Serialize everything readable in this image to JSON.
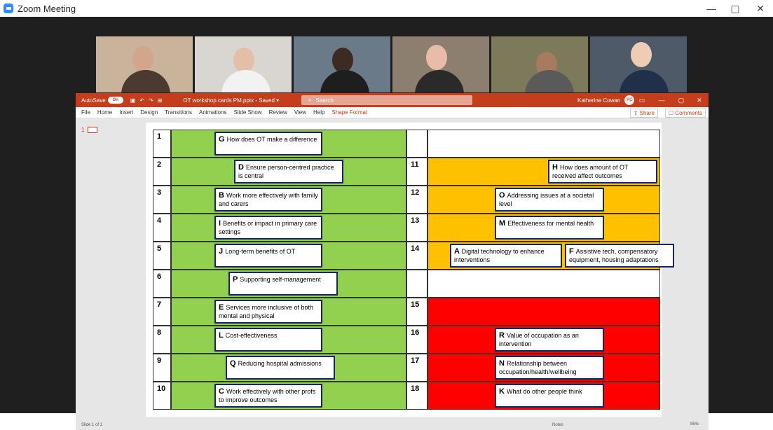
{
  "window": {
    "title": "Zoom Meeting",
    "minimize": "—",
    "restore": "▢",
    "close": "✕"
  },
  "ppt": {
    "autosave": "AutoSave",
    "autosave_state": "On",
    "doc_title": "OT workshop cards PM.pptx - Saved ▾",
    "search": "Search",
    "user": "Katherine Cowan",
    "user_initials": "KC",
    "tabs": [
      "File",
      "Home",
      "Insert",
      "Design",
      "Transitions",
      "Animations",
      "Slide Show",
      "Review",
      "View",
      "Help",
      "Shape Format"
    ],
    "share": "Share",
    "comments": "Comments",
    "slide_number": "1",
    "status": "Slide 1 of 1",
    "notes": "Notes",
    "zoom": "85%"
  },
  "rows_left": [
    {
      "num": "1",
      "card": {
        "letter": "G",
        "text": "How does OT make a difference"
      }
    },
    {
      "num": "2",
      "card": {
        "letter": "D",
        "text": "Ensure person-centred practice is central"
      }
    },
    {
      "num": "3",
      "card": {
        "letter": "B",
        "text": "Work more effectively with family and carers"
      }
    },
    {
      "num": "4",
      "card": {
        "letter": "I",
        "text": "Benefits or impact in primary care settings"
      }
    },
    {
      "num": "5",
      "card": {
        "letter": "J",
        "text": "Long-term benefits of OT"
      }
    },
    {
      "num": "6",
      "card": {
        "letter": "P",
        "text": "Supporting self-management"
      }
    },
    {
      "num": "7",
      "card": {
        "letter": "E",
        "text": "Services more inclusive of both mental and physical"
      }
    },
    {
      "num": "8",
      "card": {
        "letter": "L",
        "text": "Cost-effectiveness"
      }
    },
    {
      "num": "9",
      "card": {
        "letter": "Q",
        "text": "Reducing hospital admissions"
      }
    },
    {
      "num": "10",
      "card": {
        "letter": "C",
        "text": "Work effectively with other profs to improve outcomes"
      }
    }
  ],
  "rows_right": [
    {
      "num": "",
      "color": "#ffffff"
    },
    {
      "num": "11",
      "color": "#ffc000",
      "card": {
        "letter": "H",
        "text": "How does amount of OT received affect outcomes"
      }
    },
    {
      "num": "12",
      "color": "#ffc000",
      "card": {
        "letter": "O",
        "text": "Addressing issues at a societal level"
      }
    },
    {
      "num": "13",
      "color": "#ffc000",
      "card": {
        "letter": "M",
        "text": "Effectiveness for mental health"
      }
    },
    {
      "num": "14",
      "color": "#ffc000",
      "card": {
        "letter": "A",
        "text": "Digital technology to enhance interventions"
      },
      "card2": {
        "letter": "F",
        "text": "Assistive tech, compensatory equipment, housing adaptations"
      }
    },
    {
      "num": "",
      "color": "#ffffff"
    },
    {
      "num": "15",
      "color": "#ff0000"
    },
    {
      "num": "16",
      "color": "#ff0000",
      "card": {
        "letter": "R",
        "text": "Value of occupation as an intervention"
      }
    },
    {
      "num": "17",
      "color": "#ff0000",
      "card": {
        "letter": "N",
        "text": "Relationship between occupation/health/wellbeing"
      }
    },
    {
      "num": "18",
      "color": "#ff0000",
      "card": {
        "letter": "K",
        "text": "What do other people think"
      }
    }
  ],
  "colors": {
    "green": "#92d050",
    "amber": "#ffc000",
    "red": "#ff0000",
    "ppt_brand": "#c43e1c",
    "zoom_blue": "#2d8cff"
  }
}
